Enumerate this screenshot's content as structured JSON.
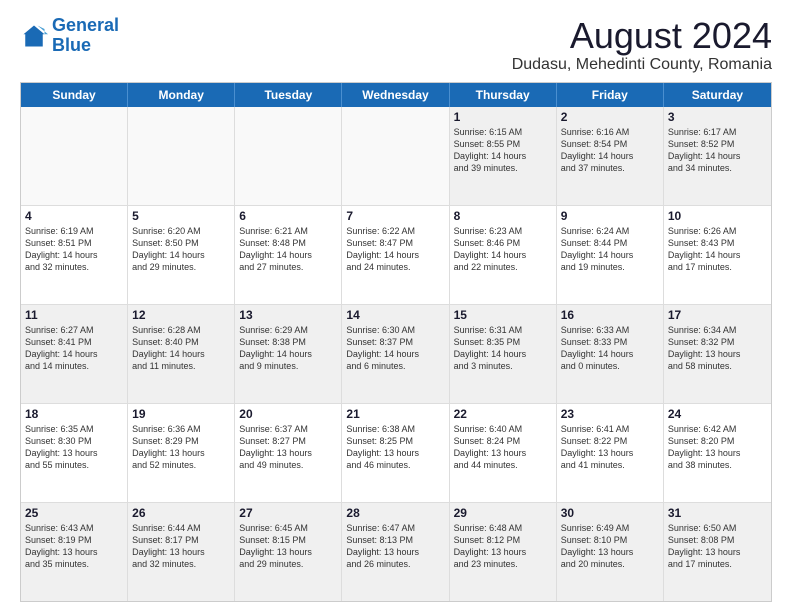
{
  "logo": {
    "line1": "General",
    "line2": "Blue"
  },
  "title": "August 2024",
  "subtitle": "Dudasu, Mehedinti County, Romania",
  "headers": [
    "Sunday",
    "Monday",
    "Tuesday",
    "Wednesday",
    "Thursday",
    "Friday",
    "Saturday"
  ],
  "rows": [
    [
      {
        "day": "",
        "text": ""
      },
      {
        "day": "",
        "text": ""
      },
      {
        "day": "",
        "text": ""
      },
      {
        "day": "",
        "text": ""
      },
      {
        "day": "1",
        "text": "Sunrise: 6:15 AM\nSunset: 8:55 PM\nDaylight: 14 hours\nand 39 minutes."
      },
      {
        "day": "2",
        "text": "Sunrise: 6:16 AM\nSunset: 8:54 PM\nDaylight: 14 hours\nand 37 minutes."
      },
      {
        "day": "3",
        "text": "Sunrise: 6:17 AM\nSunset: 8:52 PM\nDaylight: 14 hours\nand 34 minutes."
      }
    ],
    [
      {
        "day": "4",
        "text": "Sunrise: 6:19 AM\nSunset: 8:51 PM\nDaylight: 14 hours\nand 32 minutes."
      },
      {
        "day": "5",
        "text": "Sunrise: 6:20 AM\nSunset: 8:50 PM\nDaylight: 14 hours\nand 29 minutes."
      },
      {
        "day": "6",
        "text": "Sunrise: 6:21 AM\nSunset: 8:48 PM\nDaylight: 14 hours\nand 27 minutes."
      },
      {
        "day": "7",
        "text": "Sunrise: 6:22 AM\nSunset: 8:47 PM\nDaylight: 14 hours\nand 24 minutes."
      },
      {
        "day": "8",
        "text": "Sunrise: 6:23 AM\nSunset: 8:46 PM\nDaylight: 14 hours\nand 22 minutes."
      },
      {
        "day": "9",
        "text": "Sunrise: 6:24 AM\nSunset: 8:44 PM\nDaylight: 14 hours\nand 19 minutes."
      },
      {
        "day": "10",
        "text": "Sunrise: 6:26 AM\nSunset: 8:43 PM\nDaylight: 14 hours\nand 17 minutes."
      }
    ],
    [
      {
        "day": "11",
        "text": "Sunrise: 6:27 AM\nSunset: 8:41 PM\nDaylight: 14 hours\nand 14 minutes."
      },
      {
        "day": "12",
        "text": "Sunrise: 6:28 AM\nSunset: 8:40 PM\nDaylight: 14 hours\nand 11 minutes."
      },
      {
        "day": "13",
        "text": "Sunrise: 6:29 AM\nSunset: 8:38 PM\nDaylight: 14 hours\nand 9 minutes."
      },
      {
        "day": "14",
        "text": "Sunrise: 6:30 AM\nSunset: 8:37 PM\nDaylight: 14 hours\nand 6 minutes."
      },
      {
        "day": "15",
        "text": "Sunrise: 6:31 AM\nSunset: 8:35 PM\nDaylight: 14 hours\nand 3 minutes."
      },
      {
        "day": "16",
        "text": "Sunrise: 6:33 AM\nSunset: 8:33 PM\nDaylight: 14 hours\nand 0 minutes."
      },
      {
        "day": "17",
        "text": "Sunrise: 6:34 AM\nSunset: 8:32 PM\nDaylight: 13 hours\nand 58 minutes."
      }
    ],
    [
      {
        "day": "18",
        "text": "Sunrise: 6:35 AM\nSunset: 8:30 PM\nDaylight: 13 hours\nand 55 minutes."
      },
      {
        "day": "19",
        "text": "Sunrise: 6:36 AM\nSunset: 8:29 PM\nDaylight: 13 hours\nand 52 minutes."
      },
      {
        "day": "20",
        "text": "Sunrise: 6:37 AM\nSunset: 8:27 PM\nDaylight: 13 hours\nand 49 minutes."
      },
      {
        "day": "21",
        "text": "Sunrise: 6:38 AM\nSunset: 8:25 PM\nDaylight: 13 hours\nand 46 minutes."
      },
      {
        "day": "22",
        "text": "Sunrise: 6:40 AM\nSunset: 8:24 PM\nDaylight: 13 hours\nand 44 minutes."
      },
      {
        "day": "23",
        "text": "Sunrise: 6:41 AM\nSunset: 8:22 PM\nDaylight: 13 hours\nand 41 minutes."
      },
      {
        "day": "24",
        "text": "Sunrise: 6:42 AM\nSunset: 8:20 PM\nDaylight: 13 hours\nand 38 minutes."
      }
    ],
    [
      {
        "day": "25",
        "text": "Sunrise: 6:43 AM\nSunset: 8:19 PM\nDaylight: 13 hours\nand 35 minutes."
      },
      {
        "day": "26",
        "text": "Sunrise: 6:44 AM\nSunset: 8:17 PM\nDaylight: 13 hours\nand 32 minutes."
      },
      {
        "day": "27",
        "text": "Sunrise: 6:45 AM\nSunset: 8:15 PM\nDaylight: 13 hours\nand 29 minutes."
      },
      {
        "day": "28",
        "text": "Sunrise: 6:47 AM\nSunset: 8:13 PM\nDaylight: 13 hours\nand 26 minutes."
      },
      {
        "day": "29",
        "text": "Sunrise: 6:48 AM\nSunset: 8:12 PM\nDaylight: 13 hours\nand 23 minutes."
      },
      {
        "day": "30",
        "text": "Sunrise: 6:49 AM\nSunset: 8:10 PM\nDaylight: 13 hours\nand 20 minutes."
      },
      {
        "day": "31",
        "text": "Sunrise: 6:50 AM\nSunset: 8:08 PM\nDaylight: 13 hours\nand 17 minutes."
      }
    ]
  ]
}
